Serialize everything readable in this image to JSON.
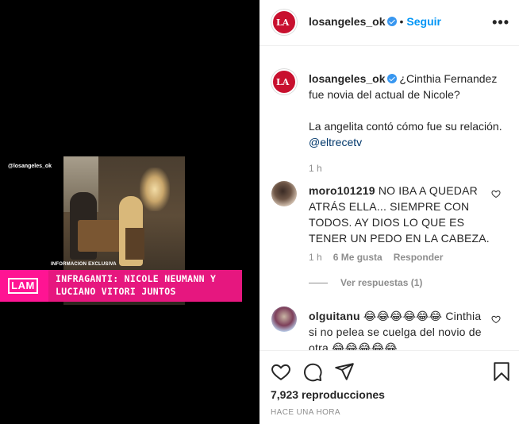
{
  "media": {
    "handle_watermark": "@losangeles_ok",
    "info_label": "INFORMACION EXCLUSIVA",
    "logo_text": "LAM",
    "banner_line1": "INFRAGANTI: NICOLE NEUMANN Y",
    "banner_line2": "LUCIANO VITORI JUNTOS",
    "banner_color": "#ff1493"
  },
  "header": {
    "username": "losangeles_ok",
    "separator": "•",
    "follow_label": "Seguir",
    "more_label": "•••"
  },
  "caption": {
    "username": "losangeles_ok",
    "line1": "¿Cinthia Fernandez fue novia del actual de Nicole?",
    "line2": "La angelita contó cómo fue su relación.",
    "mention": "@eltrecetv",
    "time": "1 h"
  },
  "comments": [
    {
      "username": "moro101219",
      "text": "NO IBA A QUEDAR ATRÁS ELLA... SIEMPRE CON TODOS. AY DIOS LO QUE ES TENER UN PEDO EN LA CABEZA.",
      "time": "1 h",
      "likes": "6 Me gusta",
      "reply_label": "Responder",
      "view_replies": "Ver respuestas (1)"
    },
    {
      "username": "olguitanu",
      "text_part1": "😂😂😂😂😂😂",
      "text_part2": "Cinthia si no pelea se cuelga del novio de otra",
      "text_part3": "😂😂😂😂😂"
    }
  ],
  "actions": {
    "icons": [
      "heart-icon",
      "comment-icon",
      "share-icon",
      "bookmark-icon"
    ],
    "views_count": "7,923",
    "views_label": "reproducciones",
    "time_ago": "HACE UNA HORA"
  },
  "colors": {
    "accent": "#0095f6",
    "verified": "#3897f0",
    "muted": "#8e8e8e"
  }
}
